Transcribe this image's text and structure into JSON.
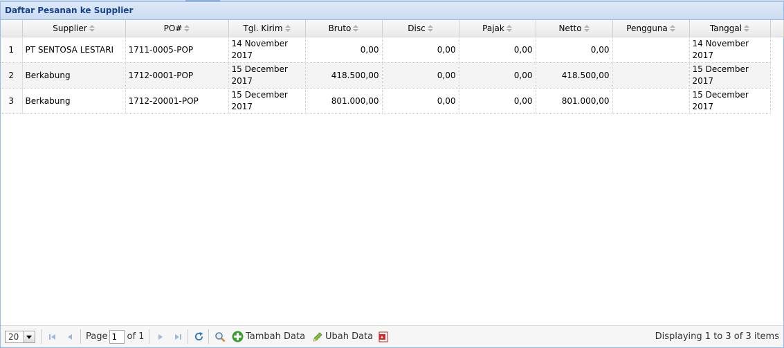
{
  "panel": {
    "title": "Daftar Pesanan ke Supplier"
  },
  "columns": [
    "Supplier",
    "PO#",
    "Tgl. Kirim",
    "Bruto",
    "Disc",
    "Pajak",
    "Netto",
    "Pengguna",
    "Tanggal"
  ],
  "rows": [
    {
      "no": "1",
      "supplier": "PT SENTOSA LESTARI",
      "po": "1711-0005-POP",
      "tgl_kirim": "14 November 2017",
      "bruto": "0,00",
      "disc": "0,00",
      "pajak": "0,00",
      "netto": "0,00",
      "pengguna": "",
      "tanggal": "14 November 2017"
    },
    {
      "no": "2",
      "supplier": "Berkabung",
      "po": "1712-0001-POP",
      "tgl_kirim": "15 December 2017",
      "bruto": "418.500,00",
      "disc": "0,00",
      "pajak": "0,00",
      "netto": "418.500,00",
      "pengguna": "",
      "tanggal": "15 December 2017"
    },
    {
      "no": "3",
      "supplier": "Berkabung",
      "po": "1712-20001-POP",
      "tgl_kirim": "15 December 2017",
      "bruto": "801.000,00",
      "disc": "0,00",
      "pajak": "0,00",
      "netto": "801.000,00",
      "pengguna": "",
      "tanggal": "15 December 2017"
    }
  ],
  "toolbar": {
    "page_size": "20",
    "page_label": "Page",
    "page_value": "1",
    "of_label": "of 1",
    "add_label": "Tambah Data",
    "edit_label": "Ubah Data",
    "display_text": "Displaying 1 to 3 of 3 items"
  },
  "icons": {
    "first": "first-page-icon",
    "prev": "prev-page-icon",
    "next": "next-page-icon",
    "last": "last-page-icon",
    "refresh": "refresh-icon",
    "search": "search-icon",
    "add": "add-icon",
    "edit": "pencil-icon",
    "pdf": "pdf-icon"
  },
  "colors": {
    "title": "#15428b",
    "border": "#99bbe8",
    "add_green": "#3c9a2e"
  }
}
